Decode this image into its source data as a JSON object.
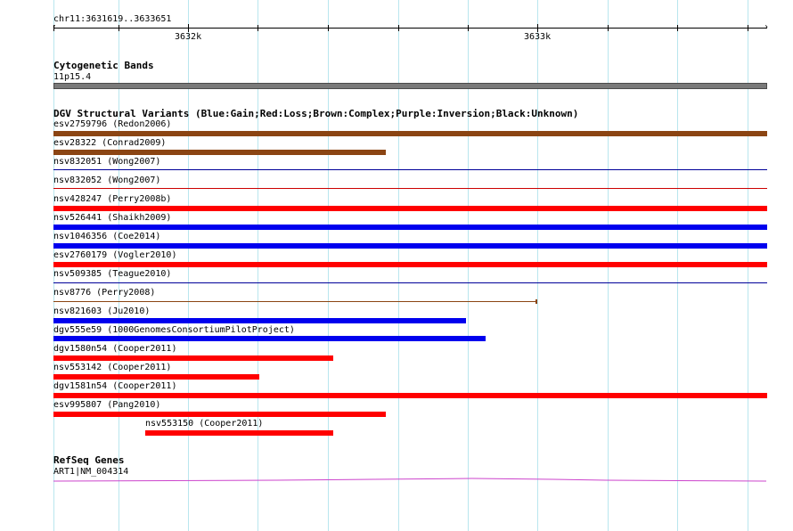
{
  "position": {
    "label": "chr11:3631619..3633651",
    "ticks": [
      "3632k",
      "3633k"
    ]
  },
  "cytobands": {
    "title": "Cytogenetic Bands",
    "band_label": "11p15.4",
    "band_color": "#7a7a7a"
  },
  "dgv": {
    "title": "DGV Structural Variants (Blue:Gain;Red:Loss;Brown:Complex;Purple:Inversion;Black:Unknown)",
    "colors": {
      "gain": "#0000ee",
      "loss": "#ff0000",
      "complex": "#8b4513",
      "inversion": "#800080",
      "unknown": "#000000",
      "thin_loss": "#cc0000",
      "thin_gain": "#000099"
    },
    "tracks": [
      {
        "label": "esv2759796 (Redon2006)",
        "type": "complex",
        "style": "bar",
        "extends": "right"
      },
      {
        "label": "esv28322 (Conrad2009)",
        "type": "complex",
        "style": "bar",
        "extends": "none"
      },
      {
        "label": "nsv832051 (Wong2007)",
        "type": "gain",
        "style": "line",
        "extends": "right"
      },
      {
        "label": "nsv832052 (Wong2007)",
        "type": "loss",
        "style": "line",
        "extends": "right"
      },
      {
        "label": "nsv428247 (Perry2008b)",
        "type": "loss",
        "style": "bar",
        "extends": "right"
      },
      {
        "label": "nsv526441 (Shaikh2009)",
        "type": "gain",
        "style": "bar",
        "extends": "right"
      },
      {
        "label": "nsv1046356 (Coe2014)",
        "type": "gain",
        "style": "bar",
        "extends": "right"
      },
      {
        "label": "esv2760179 (Vogler2010)",
        "type": "loss",
        "style": "bar",
        "extends": "right"
      },
      {
        "label": "nsv509385 (Teague2010)",
        "type": "gain",
        "style": "line",
        "extends": "right"
      },
      {
        "label": "nsv8776 (Perry2008)",
        "type": "complex",
        "style": "line",
        "extends": "none"
      },
      {
        "label": "nsv821603 (Ju2010)",
        "type": "gain",
        "style": "bar",
        "extends": "none"
      },
      {
        "label": "dgv555e59 (1000GenomesConsortiumPilotProject)",
        "type": "gain",
        "style": "bar",
        "extends": "none"
      },
      {
        "label": "dgv1580n54 (Cooper2011)",
        "type": "loss",
        "style": "bar",
        "extends": "none"
      },
      {
        "label": "nsv553142 (Cooper2011)",
        "type": "loss",
        "style": "bar",
        "extends": "none"
      },
      {
        "label": "dgv1581n54 (Cooper2011)",
        "type": "loss",
        "style": "bar",
        "extends": "right"
      },
      {
        "label": "esv995807 (Pang2010)",
        "type": "loss",
        "style": "bar",
        "extends": "none"
      },
      {
        "label": "nsv553150 (Cooper2011)",
        "type": "loss",
        "style": "bar",
        "extends": "none"
      }
    ]
  },
  "refseq": {
    "title": "RefSeq Genes",
    "gene_label": "ART1|NM_004314",
    "gene_color": "#cc44cc"
  }
}
